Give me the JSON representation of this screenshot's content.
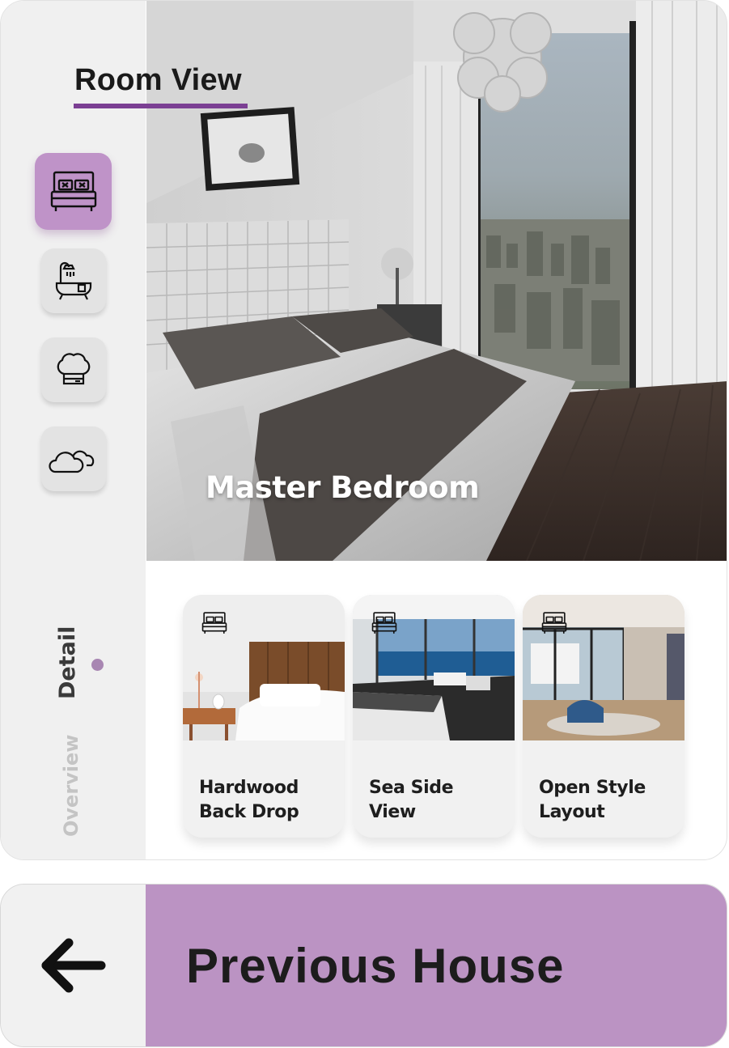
{
  "header": {
    "title": "Room View"
  },
  "room_types": [
    {
      "icon": "bed-icon",
      "active": true
    },
    {
      "icon": "bathtub-icon",
      "active": false
    },
    {
      "icon": "chef-hat-icon",
      "active": false
    },
    {
      "icon": "cloud-icon",
      "active": false
    }
  ],
  "hero": {
    "room_name": "Master Bedroom"
  },
  "view_tabs": {
    "detail": "Detail",
    "overview": "Overview",
    "active": "detail"
  },
  "thumbnails": [
    {
      "line1": "Hardwood",
      "line2": "Back Drop",
      "icon": "bed-icon"
    },
    {
      "line1": "Sea Side",
      "line2": "View",
      "icon": "bed-icon"
    },
    {
      "line1": "Open Style",
      "line2": "Layout",
      "icon": "bed-icon"
    }
  ],
  "navigation": {
    "label": "Previous House",
    "icon": "arrow-left-icon"
  },
  "colors": {
    "accent": "#7b3f93",
    "active_button": "#bf93c8",
    "nav_background": "#bb93c3",
    "sidebar": "#f0f0f0"
  }
}
